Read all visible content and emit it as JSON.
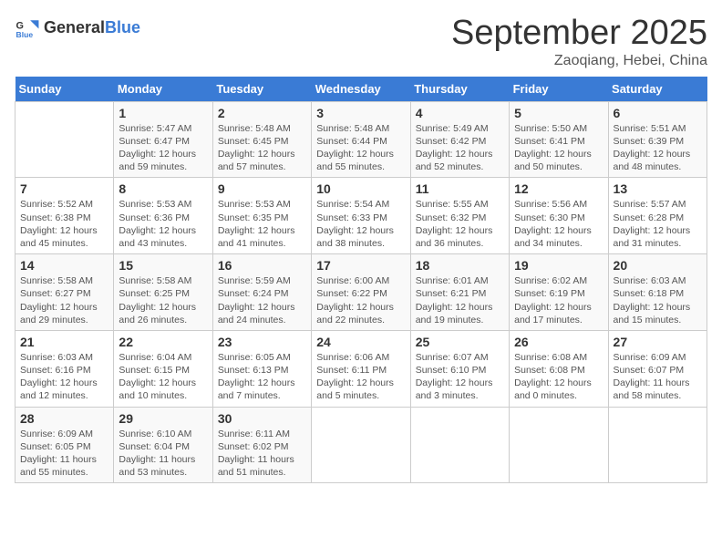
{
  "header": {
    "logo_general": "General",
    "logo_blue": "Blue",
    "month": "September 2025",
    "location": "Zaoqiang, Hebei, China"
  },
  "days_of_week": [
    "Sunday",
    "Monday",
    "Tuesday",
    "Wednesday",
    "Thursday",
    "Friday",
    "Saturday"
  ],
  "weeks": [
    [
      {
        "day": "",
        "info": ""
      },
      {
        "day": "1",
        "info": "Sunrise: 5:47 AM\nSunset: 6:47 PM\nDaylight: 12 hours\nand 59 minutes."
      },
      {
        "day": "2",
        "info": "Sunrise: 5:48 AM\nSunset: 6:45 PM\nDaylight: 12 hours\nand 57 minutes."
      },
      {
        "day": "3",
        "info": "Sunrise: 5:48 AM\nSunset: 6:44 PM\nDaylight: 12 hours\nand 55 minutes."
      },
      {
        "day": "4",
        "info": "Sunrise: 5:49 AM\nSunset: 6:42 PM\nDaylight: 12 hours\nand 52 minutes."
      },
      {
        "day": "5",
        "info": "Sunrise: 5:50 AM\nSunset: 6:41 PM\nDaylight: 12 hours\nand 50 minutes."
      },
      {
        "day": "6",
        "info": "Sunrise: 5:51 AM\nSunset: 6:39 PM\nDaylight: 12 hours\nand 48 minutes."
      }
    ],
    [
      {
        "day": "7",
        "info": "Sunrise: 5:52 AM\nSunset: 6:38 PM\nDaylight: 12 hours\nand 45 minutes."
      },
      {
        "day": "8",
        "info": "Sunrise: 5:53 AM\nSunset: 6:36 PM\nDaylight: 12 hours\nand 43 minutes."
      },
      {
        "day": "9",
        "info": "Sunrise: 5:53 AM\nSunset: 6:35 PM\nDaylight: 12 hours\nand 41 minutes."
      },
      {
        "day": "10",
        "info": "Sunrise: 5:54 AM\nSunset: 6:33 PM\nDaylight: 12 hours\nand 38 minutes."
      },
      {
        "day": "11",
        "info": "Sunrise: 5:55 AM\nSunset: 6:32 PM\nDaylight: 12 hours\nand 36 minutes."
      },
      {
        "day": "12",
        "info": "Sunrise: 5:56 AM\nSunset: 6:30 PM\nDaylight: 12 hours\nand 34 minutes."
      },
      {
        "day": "13",
        "info": "Sunrise: 5:57 AM\nSunset: 6:28 PM\nDaylight: 12 hours\nand 31 minutes."
      }
    ],
    [
      {
        "day": "14",
        "info": "Sunrise: 5:58 AM\nSunset: 6:27 PM\nDaylight: 12 hours\nand 29 minutes."
      },
      {
        "day": "15",
        "info": "Sunrise: 5:58 AM\nSunset: 6:25 PM\nDaylight: 12 hours\nand 26 minutes."
      },
      {
        "day": "16",
        "info": "Sunrise: 5:59 AM\nSunset: 6:24 PM\nDaylight: 12 hours\nand 24 minutes."
      },
      {
        "day": "17",
        "info": "Sunrise: 6:00 AM\nSunset: 6:22 PM\nDaylight: 12 hours\nand 22 minutes."
      },
      {
        "day": "18",
        "info": "Sunrise: 6:01 AM\nSunset: 6:21 PM\nDaylight: 12 hours\nand 19 minutes."
      },
      {
        "day": "19",
        "info": "Sunrise: 6:02 AM\nSunset: 6:19 PM\nDaylight: 12 hours\nand 17 minutes."
      },
      {
        "day": "20",
        "info": "Sunrise: 6:03 AM\nSunset: 6:18 PM\nDaylight: 12 hours\nand 15 minutes."
      }
    ],
    [
      {
        "day": "21",
        "info": "Sunrise: 6:03 AM\nSunset: 6:16 PM\nDaylight: 12 hours\nand 12 minutes."
      },
      {
        "day": "22",
        "info": "Sunrise: 6:04 AM\nSunset: 6:15 PM\nDaylight: 12 hours\nand 10 minutes."
      },
      {
        "day": "23",
        "info": "Sunrise: 6:05 AM\nSunset: 6:13 PM\nDaylight: 12 hours\nand 7 minutes."
      },
      {
        "day": "24",
        "info": "Sunrise: 6:06 AM\nSunset: 6:11 PM\nDaylight: 12 hours\nand 5 minutes."
      },
      {
        "day": "25",
        "info": "Sunrise: 6:07 AM\nSunset: 6:10 PM\nDaylight: 12 hours\nand 3 minutes."
      },
      {
        "day": "26",
        "info": "Sunrise: 6:08 AM\nSunset: 6:08 PM\nDaylight: 12 hours\nand 0 minutes."
      },
      {
        "day": "27",
        "info": "Sunrise: 6:09 AM\nSunset: 6:07 PM\nDaylight: 11 hours\nand 58 minutes."
      }
    ],
    [
      {
        "day": "28",
        "info": "Sunrise: 6:09 AM\nSunset: 6:05 PM\nDaylight: 11 hours\nand 55 minutes."
      },
      {
        "day": "29",
        "info": "Sunrise: 6:10 AM\nSunset: 6:04 PM\nDaylight: 11 hours\nand 53 minutes."
      },
      {
        "day": "30",
        "info": "Sunrise: 6:11 AM\nSunset: 6:02 PM\nDaylight: 11 hours\nand 51 minutes."
      },
      {
        "day": "",
        "info": ""
      },
      {
        "day": "",
        "info": ""
      },
      {
        "day": "",
        "info": ""
      },
      {
        "day": "",
        "info": ""
      }
    ]
  ]
}
